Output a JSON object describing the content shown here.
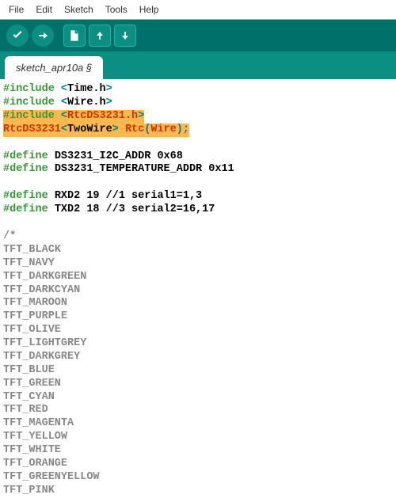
{
  "menubar": {
    "file": "File",
    "edit": "Edit",
    "sketch": "Sketch",
    "tools": "Tools",
    "help": "Help"
  },
  "tab": {
    "name": "sketch_apr10a §"
  },
  "code": {
    "line1_inc": "#include ",
    "line1_lt": "<",
    "line1_h": "Time.h",
    "line1_gt": ">",
    "line2_inc": "#include ",
    "line2_lt": "<",
    "line2_h": "Wire.h",
    "line2_gt": ">",
    "line3_inc": "#include ",
    "line3_lt": "<",
    "line3_h": "RtcDS3231.h",
    "line3_gt": ">",
    "line4_a": "RtcDS3231",
    "line4_lt": "<",
    "line4_b": "TwoWire",
    "line4_gt": "> ",
    "line4_c": "Rtc",
    "line4_lp": "(",
    "line4_d": "Wire",
    "line4_rp": ");",
    "def1_a": "#define ",
    "def1_b": "DS3231_I2C_ADDR",
    "def1_c": "             0x68",
    "def2_a": "#define ",
    "def2_b": "DS3231_TEMPERATURE_ADDR",
    "def2_c": "     0x11",
    "def3_a": "#define ",
    "def3_b": "RXD2 19",
    "def3_c": "    //1 serial1=1,3",
    "def4_a": "#define ",
    "def4_b": "TXD2 18",
    "def4_c": "    //3 serial2=16,17",
    "cm_open": "/*",
    "c1": "TFT_BLACK",
    "c2": "TFT_NAVY",
    "c3": "TFT_DARKGREEN",
    "c4": "TFT_DARKCYAN",
    "c5": "TFT_MAROON",
    "c6": "TFT_PURPLE",
    "c7": "TFT_OLIVE",
    "c8": "TFT_LIGHTGREY",
    "c9": "TFT_DARKGREY",
    "c10": "TFT_BLUE",
    "c11": "TFT_GREEN",
    "c12": "TFT_CYAN",
    "c13": "TFT_RED",
    "c14": "TFT_MAGENTA",
    "c15": "TFT_YELLOW",
    "c16": "TFT_WHITE",
    "c17": "TFT_ORANGE",
    "c18": "TFT_GREENYELLOW",
    "c19": "TFT_PINK"
  }
}
